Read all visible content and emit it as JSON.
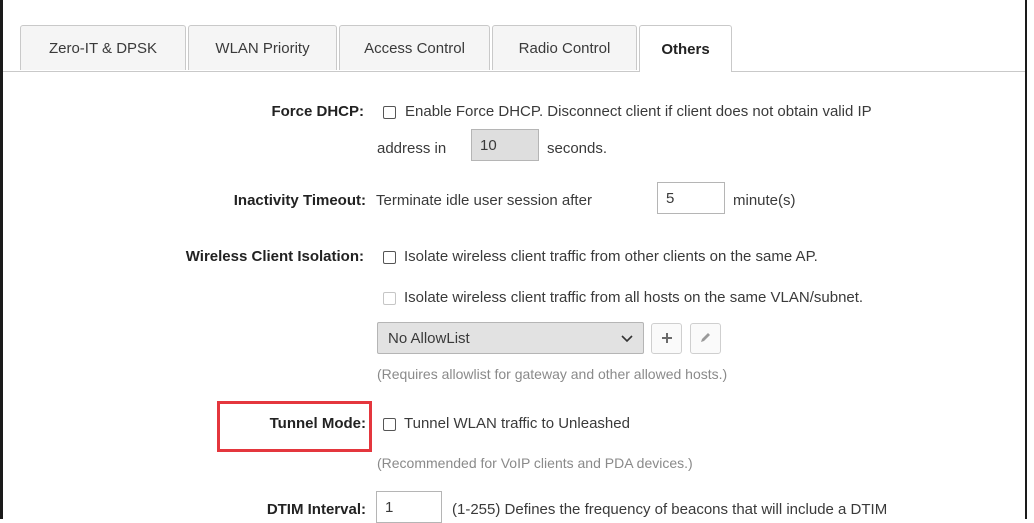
{
  "tabs": [
    {
      "label": "Zero-IT & DPSK"
    },
    {
      "label": "WLAN Priority"
    },
    {
      "label": "Access Control"
    },
    {
      "label": "Radio Control"
    },
    {
      "label": "Others",
      "active": true
    }
  ],
  "force_dhcp": {
    "label": "Force DHCP:",
    "text_line1": "Enable Force DHCP. Disconnect client if client does not obtain valid IP",
    "text_prefix": "address in",
    "value": "10",
    "text_suffix": "seconds.",
    "checked": false
  },
  "inactivity_timeout": {
    "label": "Inactivity Timeout:",
    "text_prefix": "Terminate idle user session after",
    "value": "5",
    "text_suffix": "minute(s)"
  },
  "wireless_client_isolation": {
    "label": "Wireless Client Isolation:",
    "option1": "Isolate wireless client traffic from other clients on the same AP.",
    "option2": "Isolate wireless client traffic from all hosts on the same VLAN/subnet.",
    "allowlist_selected": "No AllowList",
    "hint": "(Requires allowlist for gateway and other allowed hosts.)"
  },
  "tunnel_mode": {
    "label": "Tunnel Mode:",
    "text": "Tunnel WLAN traffic to Unleashed",
    "hint": "(Recommended for VoIP clients and PDA devices.)",
    "checked": false
  },
  "dtim_interval": {
    "label": "DTIM Interval:",
    "value": "1",
    "text": "(1-255) Defines the frequency of beacons that will include a DTIM"
  },
  "colors": {
    "highlight": "#e4363d",
    "label": "#222222",
    "hint": "#8a8a8a"
  },
  "icons": [
    "chevron-down-icon",
    "plus-icon",
    "pencil-icon"
  ]
}
